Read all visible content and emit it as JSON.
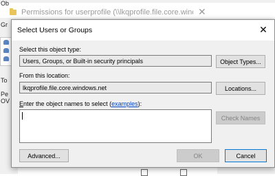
{
  "background_window": {
    "title": "Permissions for userprofile (\\\\lkqprofile.file.core.windo...",
    "close_glyph": "✕",
    "fragments": {
      "obj": "Ob",
      "gr": "Gr",
      "to": "To",
      "pe": "Pe",
      "ov": "OV"
    }
  },
  "dialog": {
    "title": "Select Users or Groups",
    "close_glyph": "✕",
    "object_type_label": "Select this object type:",
    "object_type_value": "Users, Groups, or Built-in security principals",
    "object_types_button": "Object Types...",
    "location_label": "From this location:",
    "location_value": "lkqprofile.file.core.windows.net",
    "locations_button": "Locations...",
    "names_label_accel": "E",
    "names_label_rest": "nter the object names to select (",
    "names_label_link": "examples",
    "names_label_end": "):",
    "names_value": "",
    "check_names_button": "Check Names",
    "advanced_button": "Advanced...",
    "ok_button": "OK",
    "cancel_button": "Cancel"
  }
}
